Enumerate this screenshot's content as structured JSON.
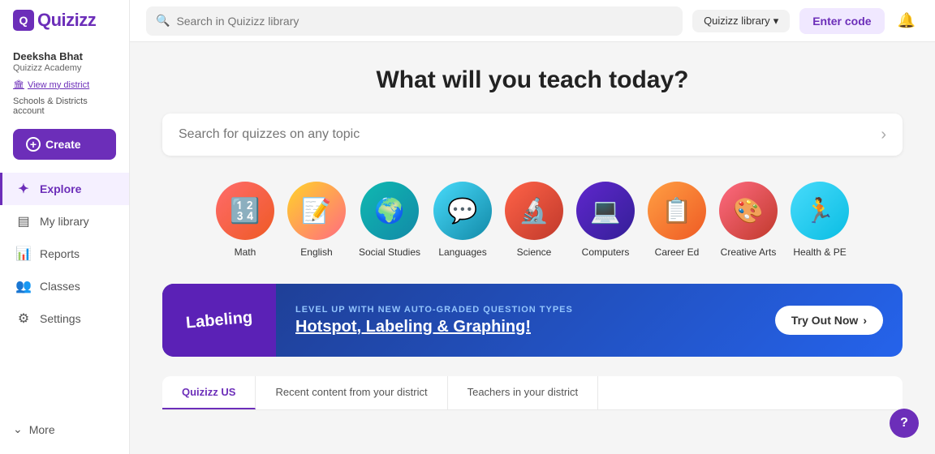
{
  "sidebar": {
    "logo_text": "Quizizz",
    "user": {
      "name": "Deeksha Bhat",
      "org": "Quizizz Academy",
      "view_district_label": "View my district",
      "schools_label": "Schools & Districts account"
    },
    "create_label": "Create",
    "nav_items": [
      {
        "id": "explore",
        "label": "Explore",
        "icon": "⊕",
        "active": true
      },
      {
        "id": "my-library",
        "label": "My library",
        "icon": "☰",
        "active": false
      },
      {
        "id": "reports",
        "label": "Reports",
        "icon": "📊",
        "active": false
      },
      {
        "id": "classes",
        "label": "Classes",
        "icon": "🎓",
        "active": false
      },
      {
        "id": "settings",
        "label": "Settings",
        "icon": "⚙",
        "active": false
      }
    ],
    "more_label": "More"
  },
  "topbar": {
    "search_placeholder": "Search in Quizizz library",
    "library_dropdown_label": "Quizizz library",
    "enter_code_label": "Enter code",
    "bell_icon": "🔔"
  },
  "main": {
    "hero_title": "What will you teach today?",
    "search_placeholder": "Search for quizzes on any topic",
    "categories": [
      {
        "id": "math",
        "label": "Math",
        "icon": "🔢",
        "color_class": "cat-math"
      },
      {
        "id": "english",
        "label": "English",
        "icon": "📝",
        "color_class": "cat-english"
      },
      {
        "id": "social-studies",
        "label": "Social Studies",
        "icon": "🌍",
        "color_class": "cat-social"
      },
      {
        "id": "languages",
        "label": "Languages",
        "icon": "💬",
        "color_class": "cat-languages"
      },
      {
        "id": "science",
        "label": "Science",
        "icon": "🔬",
        "color_class": "cat-science"
      },
      {
        "id": "computers",
        "label": "Computers",
        "icon": "💻",
        "color_class": "cat-computers"
      },
      {
        "id": "career-ed",
        "label": "Career Ed",
        "icon": "📋",
        "color_class": "cat-career"
      },
      {
        "id": "creative-arts",
        "label": "Creative Arts",
        "icon": "🎨",
        "color_class": "cat-creative"
      },
      {
        "id": "health-pe",
        "label": "Health & PE",
        "icon": "🏃",
        "color_class": "cat-health"
      }
    ],
    "banner": {
      "label": "Labeling",
      "subtitle": "LEVEL UP WITH NEW AUTO-GRADED QUESTION TYPES",
      "title": "Hotspot, Labeling & Graphing!",
      "cta": "Try Out Now"
    },
    "bottom_tabs": [
      {
        "id": "quizizz-us",
        "label": "Quizizz US",
        "active": true
      },
      {
        "id": "recent-content",
        "label": "Recent content from your district",
        "active": false
      },
      {
        "id": "teachers-district",
        "label": "Teachers in your district",
        "active": false
      }
    ]
  }
}
